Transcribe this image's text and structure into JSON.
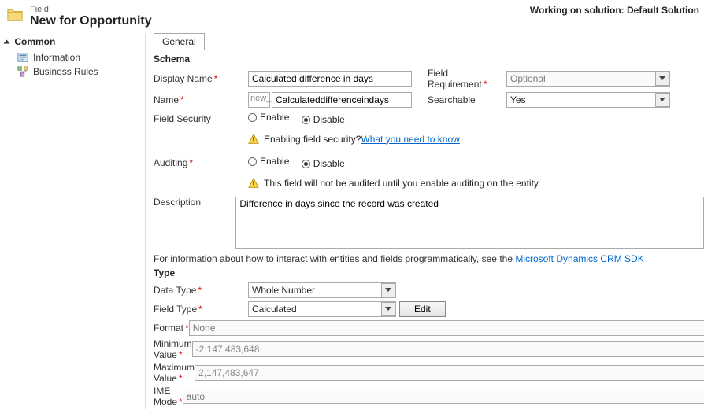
{
  "header": {
    "field_label": "Field",
    "title": "New for Opportunity",
    "solution_text": "Working on solution: Default Solution"
  },
  "sidebar": {
    "section": "Common",
    "items": [
      {
        "label": "Information"
      },
      {
        "label": "Business Rules"
      }
    ]
  },
  "tab": {
    "general": "General"
  },
  "schema": {
    "heading": "Schema",
    "display_name_lbl": "Display Name",
    "display_name_val": "Calculated difference in days",
    "field_req_lbl": "Field Requirement",
    "field_req_val": "Optional",
    "name_lbl": "Name",
    "name_prefix": "new_",
    "name_val": "Calculateddifferenceindays",
    "searchable_lbl": "Searchable",
    "searchable_val": "Yes",
    "field_security_lbl": "Field Security",
    "enable": "Enable",
    "disable": "Disable",
    "security_hint_pre": "Enabling field security? ",
    "security_hint_link": "What you need to know",
    "auditing_lbl": "Auditing",
    "auditing_hint": "This field will not be audited until you enable auditing on the entity.",
    "description_lbl": "Description",
    "description_val": "Difference in days since the record was created"
  },
  "info_line_pre": "For information about how to interact with entities and fields programmatically, see the ",
  "info_line_link": "Microsoft Dynamics CRM SDK",
  "type": {
    "heading": "Type",
    "data_type_lbl": "Data Type",
    "data_type_val": "Whole Number",
    "field_type_lbl": "Field Type",
    "field_type_val": "Calculated",
    "edit_btn": "Edit",
    "format_lbl": "Format",
    "format_val": "None",
    "min_lbl": "Minimum Value",
    "min_val": "-2,147,483,648",
    "max_lbl": "Maximum Value",
    "max_val": "2,147,483,647",
    "ime_lbl": "IME Mode",
    "ime_val": "auto"
  }
}
